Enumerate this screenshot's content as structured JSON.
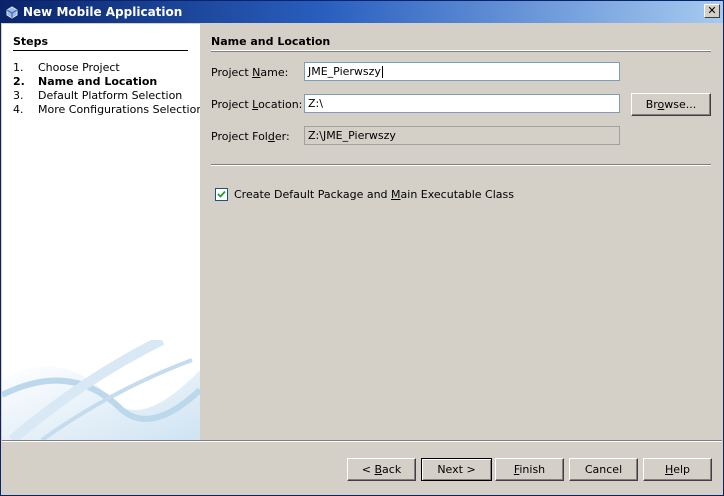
{
  "window": {
    "title": "New Mobile Application",
    "close_glyph": "✕",
    "app_icon": "coffee-cup-icon"
  },
  "steps": {
    "title": "Steps",
    "items": [
      {
        "num": "1.",
        "label": "Choose Project",
        "current": false
      },
      {
        "num": "2.",
        "label": "Name and Location",
        "current": true
      },
      {
        "num": "3.",
        "label": "Default Platform Selection",
        "current": false
      },
      {
        "num": "4.",
        "label": "More Configurations Selection",
        "current": false
      }
    ]
  },
  "panel": {
    "title": "Name and Location",
    "project_name_label_pre": "Project ",
    "project_name_label_mnemonic": "N",
    "project_name_label_post": "ame:",
    "project_name_value": "JME_Pierwszy",
    "project_location_label_pre": "Project ",
    "project_location_label_mnemonic": "L",
    "project_location_label_post": "ocation:",
    "project_location_value": "Z:\\",
    "browse_label_pre": "Br",
    "browse_label_mnemonic": "o",
    "browse_label_post": "wse...",
    "project_folder_label_pre": "Project Fol",
    "project_folder_label_mnemonic": "d",
    "project_folder_label_post": "er:",
    "project_folder_value": "Z:\\JME_Pierwszy",
    "checkbox_checked": true,
    "checkbox_label_pre": "Create Default Package and ",
    "checkbox_label_mnemonic": "M",
    "checkbox_label_post": "ain Executable Class"
  },
  "buttons": {
    "back_pre": "< ",
    "back_mnemonic": "B",
    "back_post": "ack",
    "next_label": "Next >",
    "finish_mnemonic": "F",
    "finish_post": "inish",
    "cancel_label": "Cancel",
    "help_mnemonic": "H",
    "help_post": "elp"
  },
  "colors": {
    "title_bar": "#0a246a",
    "dialog_bg": "#d4d0c8",
    "steps_bg": "#ffffff"
  }
}
